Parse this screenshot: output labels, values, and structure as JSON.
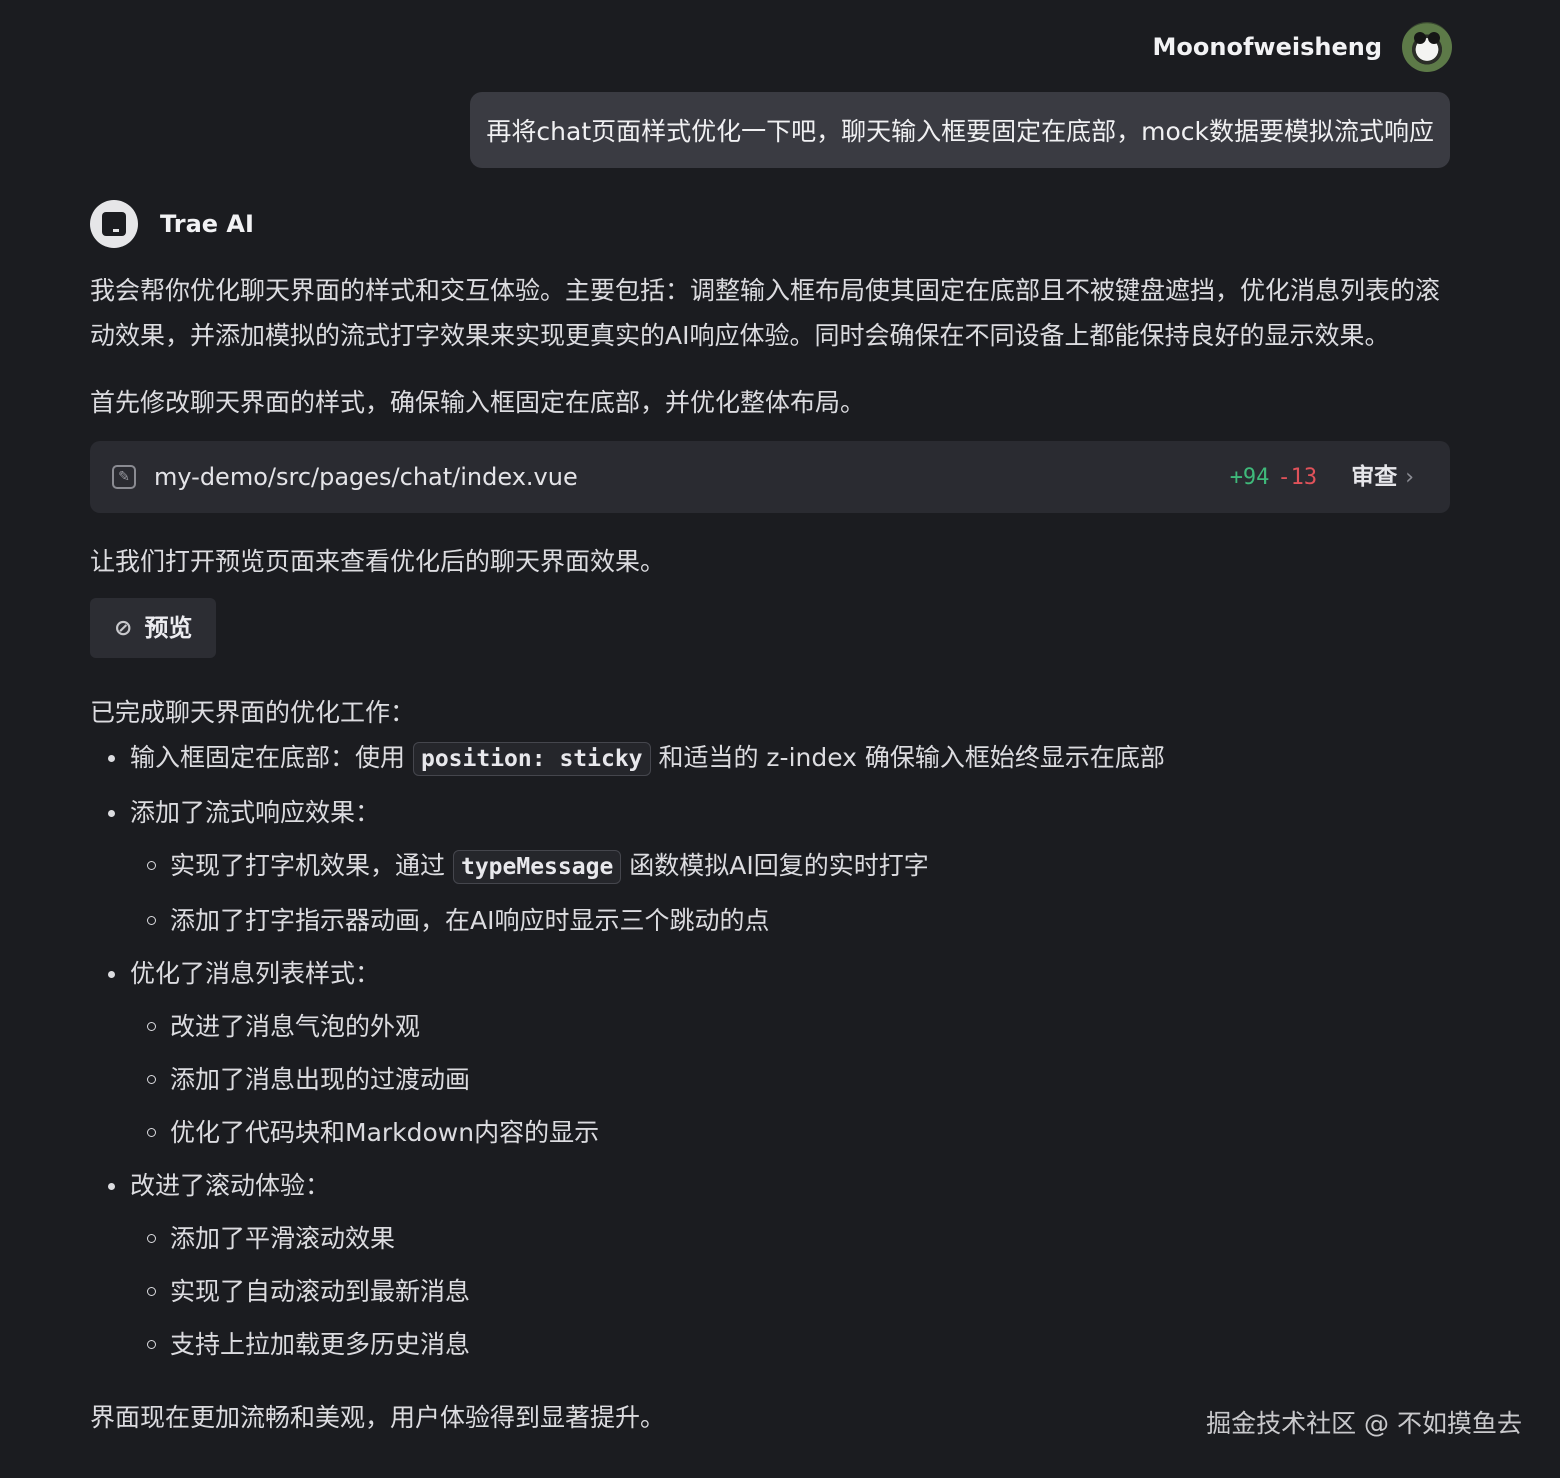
{
  "user": {
    "name": "Moonofweisheng",
    "avatar_icon": "panda-avatar",
    "message": "再将chat页面样式优化一下吧，聊天输入框要固定在底部，mock数据要模拟流式响应"
  },
  "assistant": {
    "name": "Trae AI",
    "intro": "我会帮你优化聊天界面的样式和交互体验。主要包括：调整输入框布局使其固定在底部且不被键盘遮挡，优化消息列表的滚动效果，并添加模拟的流式打字效果来实现更真实的AI响应体验。同时会确保在不同设备上都能保持良好的显示效果。",
    "step1": "首先修改聊天界面的样式，确保输入框固定在底部，并优化整体布局。",
    "file_card": {
      "path": "my-demo/src/pages/chat/index.vue",
      "additions": "+94",
      "deletions": "-13",
      "review_label": "审查"
    },
    "step2": "让我们打开预览页面来查看优化后的聊天界面效果。",
    "preview_label": "预览",
    "summary_title": "已完成聊天界面的优化工作：",
    "bullets": {
      "b1_pre": "输入框固定在底部：使用",
      "b1_code": "position: sticky",
      "b1_post": "和适当的 z-index 确保输入框始终显示在底部",
      "b2": "添加了流式响应效果：",
      "b2_1_pre": "实现了打字机效果，通过",
      "b2_1_code": "typeMessage",
      "b2_1_post": "函数模拟AI回复的实时打字",
      "b2_2": "添加了打字指示器动画，在AI响应时显示三个跳动的点",
      "b3": "优化了消息列表样式：",
      "b3_1": "改进了消息气泡的外观",
      "b3_2": "添加了消息出现的过渡动画",
      "b3_3": "优化了代码块和Markdown内容的显示",
      "b4": "改进了滚动体验：",
      "b4_1": "添加了平滑滚动效果",
      "b4_2": "实现了自动滚动到最新消息",
      "b4_3": "支持上拉加载更多历史消息"
    },
    "conclusion": "界面现在更加流畅和美观，用户体验得到显著提升。"
  },
  "watermark": "掘金技术社区 @ 不如摸鱼去"
}
